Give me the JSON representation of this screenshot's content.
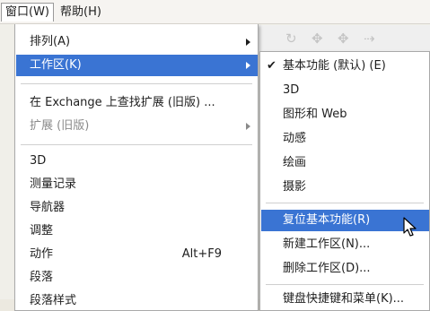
{
  "menubar": {
    "window_label": "窗口(W)",
    "help_label": "帮助(H)"
  },
  "main_menu": {
    "items": [
      {
        "label": "排列(A)",
        "has_submenu": true
      },
      {
        "label": "工作区(K)",
        "has_submenu": true,
        "highlighted": true
      },
      {
        "label": "在 Exchange 上查找扩展 (旧版) ..."
      },
      {
        "label": "扩展 (旧版)",
        "has_submenu": true,
        "disabled": true
      },
      {
        "label": "3D"
      },
      {
        "label": "测量记录"
      },
      {
        "label": "导航器"
      },
      {
        "label": "调整"
      },
      {
        "label": "动作",
        "shortcut": "Alt+F9"
      },
      {
        "label": "段落"
      },
      {
        "label": "段落样式"
      }
    ]
  },
  "workspace_submenu": {
    "items": [
      {
        "label": "基本功能 (默认) (E)",
        "checked": true
      },
      {
        "label": "3D"
      },
      {
        "label": "图形和 Web"
      },
      {
        "label": "动感"
      },
      {
        "label": "绘画"
      },
      {
        "label": "摄影"
      },
      {
        "label": "复位基本功能(R)",
        "highlighted": true
      },
      {
        "label": "新建工作区(N)..."
      },
      {
        "label": "删除工作区(D)..."
      },
      {
        "label": "键盘快捷键和菜单(K)..."
      }
    ]
  },
  "check_glyph": "✔",
  "accent_color": "#3a74d3"
}
